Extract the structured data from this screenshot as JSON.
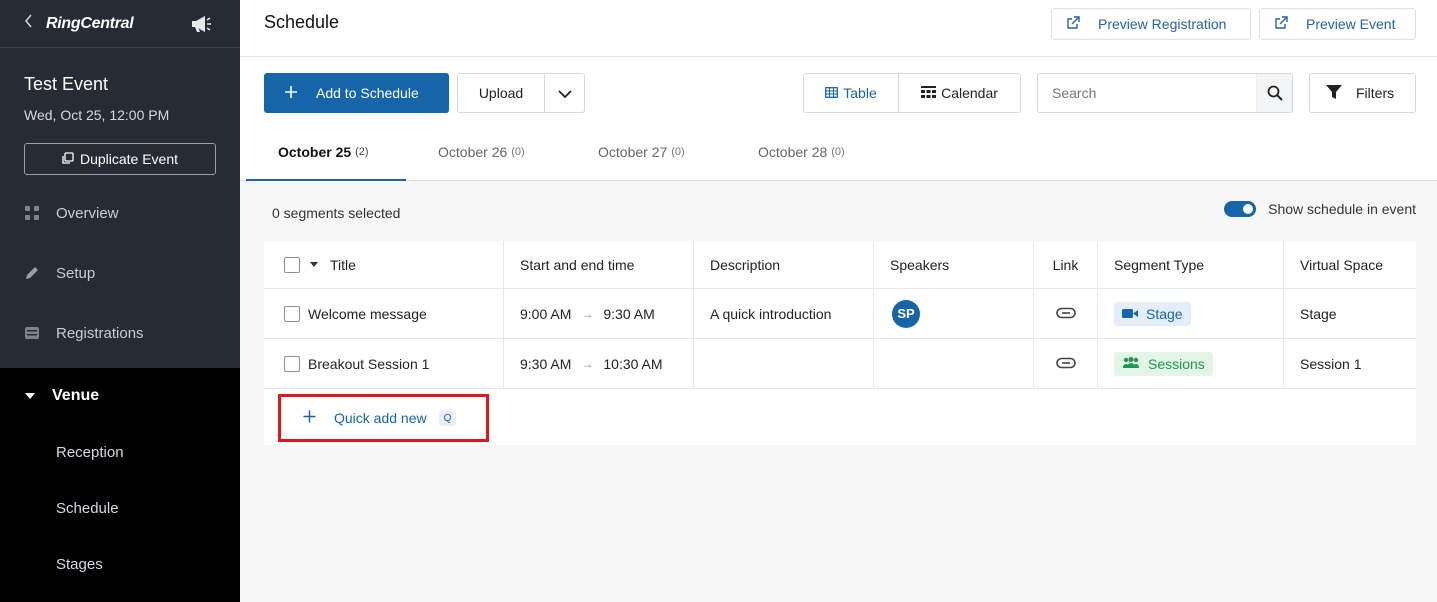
{
  "sidebar": {
    "brand": "RingCentral",
    "event_name": "Test Event",
    "event_date": "Wed, Oct 25, 12:00 PM",
    "duplicate_label": "Duplicate Event",
    "nav": [
      {
        "label": "Overview",
        "icon": "grid-icon"
      },
      {
        "label": "Setup",
        "icon": "pencil-icon"
      },
      {
        "label": "Registrations",
        "icon": "card-icon"
      }
    ],
    "venue": {
      "label": "Venue",
      "items": [
        "Reception",
        "Schedule",
        "Stages"
      ]
    }
  },
  "header": {
    "title": "Schedule",
    "preview_registration": "Preview Registration",
    "preview_event": "Preview Event"
  },
  "toolbar": {
    "add_label": "Add to Schedule",
    "upload_label": "Upload",
    "view_table": "Table",
    "view_calendar": "Calendar",
    "search_placeholder": "Search",
    "filters_label": "Filters"
  },
  "tabs": [
    {
      "label": "October 25",
      "count": "(2)"
    },
    {
      "label": "October 26",
      "count": "(0)"
    },
    {
      "label": "October 27",
      "count": "(0)"
    },
    {
      "label": "October 28",
      "count": "(0)"
    }
  ],
  "selection": {
    "count_text": "0 segments selected",
    "toggle_label": "Show schedule in event"
  },
  "table": {
    "columns": [
      "Title",
      "Start and end time",
      "Description",
      "Speakers",
      "Link",
      "Segment Type",
      "Virtual Space"
    ],
    "rows": [
      {
        "title": "Welcome message",
        "start": "9:00 AM",
        "end": "9:30 AM",
        "description": "A quick introduction",
        "speaker": "SP",
        "segment_type": "Stage",
        "virtual_space": "Stage"
      },
      {
        "title": "Breakout Session 1",
        "start": "9:30 AM",
        "end": "10:30 AM",
        "description": "",
        "speaker": "",
        "segment_type": "Sessions",
        "virtual_space": "Session 1"
      }
    ],
    "quick_add_label": "Quick add new",
    "quick_add_key": "Q"
  },
  "colors": {
    "accent": "#1565a8",
    "sidebar_bg": "#272b33",
    "sessions_green": "#1e9a4a",
    "highlight_red": "#e5141a"
  }
}
